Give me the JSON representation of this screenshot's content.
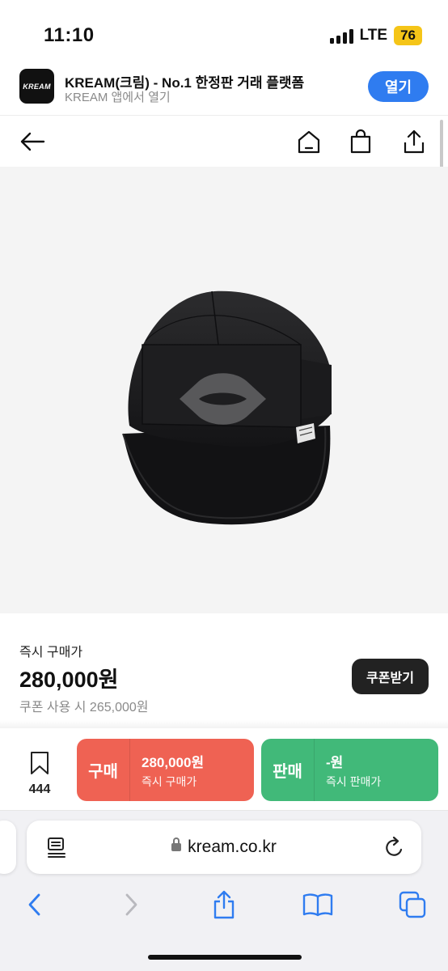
{
  "status_bar": {
    "time": "11:10",
    "network": "LTE",
    "battery": "76"
  },
  "app_banner": {
    "logo_text": "KREAM",
    "title": "KREAM(크림) - No.1 한정판 거래 플랫폼",
    "subtitle": "KREAM 앱에서 열기",
    "open_label": "열기",
    "open_color": "#2f7cf0"
  },
  "nav": {
    "icons": [
      "back-arrow-icon",
      "home-icon",
      "shopping-bag-icon",
      "share-icon"
    ]
  },
  "product": {
    "image": "black-five-panel-cap",
    "price_label": "즉시 구매가",
    "price": "280,000원",
    "coupon_price": "쿠폰 사용 시 265,000원",
    "coupon_button": "쿠폰받기"
  },
  "actions": {
    "wish_count": "444",
    "buy": {
      "tag": "구매",
      "price": "280,000원",
      "sub": "즉시 구매가",
      "color": "#ef6253"
    },
    "sell": {
      "tag": "판매",
      "price": "-원",
      "sub": "즉시 판매가",
      "color": "#41b979"
    }
  },
  "browser": {
    "url": "kream.co.kr",
    "toolbar": [
      "back-icon",
      "forward-icon",
      "share-icon",
      "bookmarks-icon",
      "tabs-icon"
    ]
  }
}
